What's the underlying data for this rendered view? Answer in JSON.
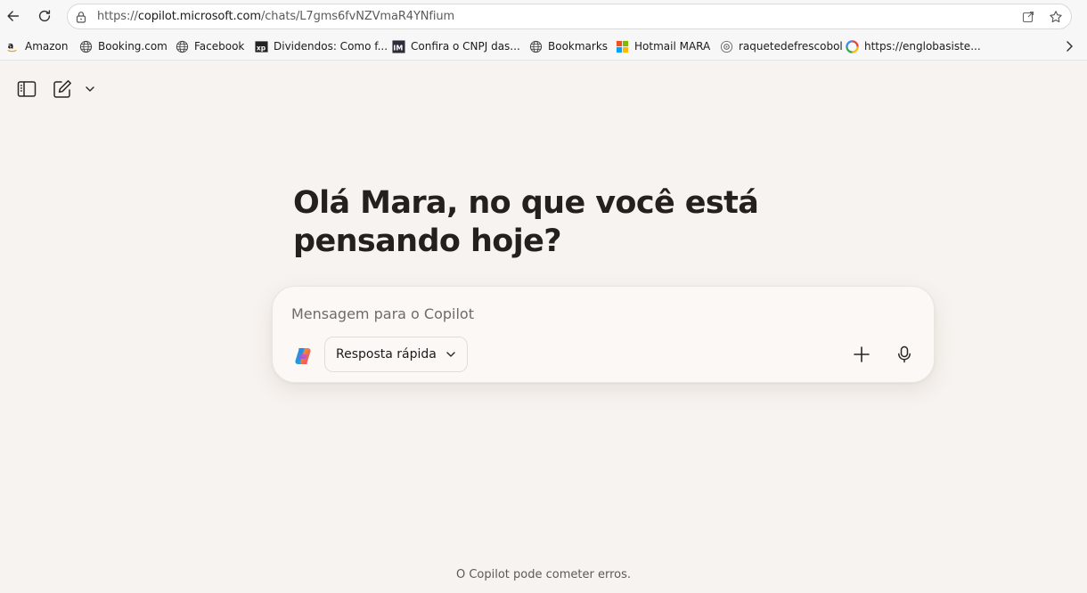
{
  "browser": {
    "url_scheme": "https://",
    "url_host": "copilot.microsoft.com",
    "url_path": "/chats/L7gms6fvNZVmaR4YNfium",
    "bookmarks": [
      {
        "label": "Amazon",
        "icon": "amazon-icon"
      },
      {
        "label": "Booking.com",
        "icon": "globe-icon"
      },
      {
        "label": "Facebook",
        "icon": "globe-icon"
      },
      {
        "label": "Dividendos: Como f...",
        "icon": "xp-icon"
      },
      {
        "label": "Confira o CNPJ das...",
        "icon": "im-icon"
      },
      {
        "label": "Bookmarks",
        "icon": "globe-icon"
      },
      {
        "label": "Hotmail MARA",
        "icon": "microsoft-icon"
      },
      {
        "label": "raquetedefrescobol",
        "icon": "gear-badge-icon"
      },
      {
        "label": "https://englobasiste...",
        "icon": "colorful-ring-icon"
      }
    ]
  },
  "app": {
    "greeting": "Olá Mara, no que você está pensando hoje?",
    "composer": {
      "placeholder": "Mensagem para o Copilot",
      "mode_label": "Resposta rápida"
    },
    "footer": "O Copilot pode cometer erros.",
    "colors": {
      "background": "#f7f3f0",
      "composer_bg": "#fbf8f5",
      "text": "#25201d"
    }
  }
}
